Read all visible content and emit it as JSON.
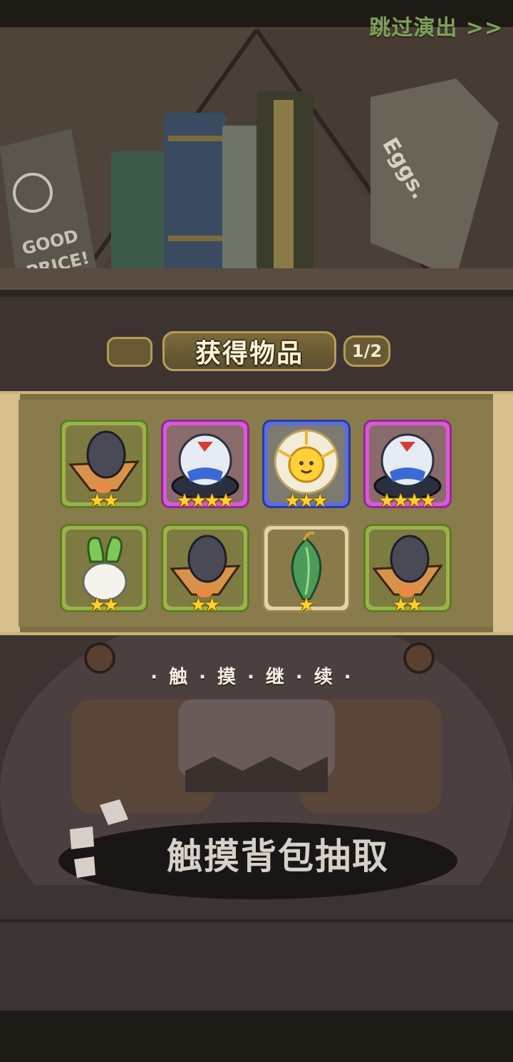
{
  "header": {
    "skip_label": "跳过演出 >>"
  },
  "title": {
    "text": "获得物品",
    "page": "1/2"
  },
  "items": [
    {
      "name": "egg-hat",
      "rarity": "green",
      "stars": 2
    },
    {
      "name": "crystal-orb",
      "rarity": "purple",
      "stars": 4
    },
    {
      "name": "sun-spirit",
      "rarity": "blue",
      "stars": 3
    },
    {
      "name": "crystal-orb",
      "rarity": "purple",
      "stars": 4
    },
    {
      "name": "radish",
      "rarity": "green",
      "stars": 2
    },
    {
      "name": "egg-hat",
      "rarity": "green",
      "stars": 2
    },
    {
      "name": "leaf-bud",
      "rarity": "tan",
      "stars": 1
    },
    {
      "name": "egg-hat",
      "rarity": "green",
      "stars": 2
    }
  ],
  "continue_text": "·触·摸·继·续·",
  "touch_bag_text": "触摸背包抽取",
  "colors": {
    "green": "#9bb24a",
    "purple": "#d85ad8",
    "blue": "#5b6ee0",
    "tan": "#e2d2a4",
    "star": "#ffd22e"
  }
}
